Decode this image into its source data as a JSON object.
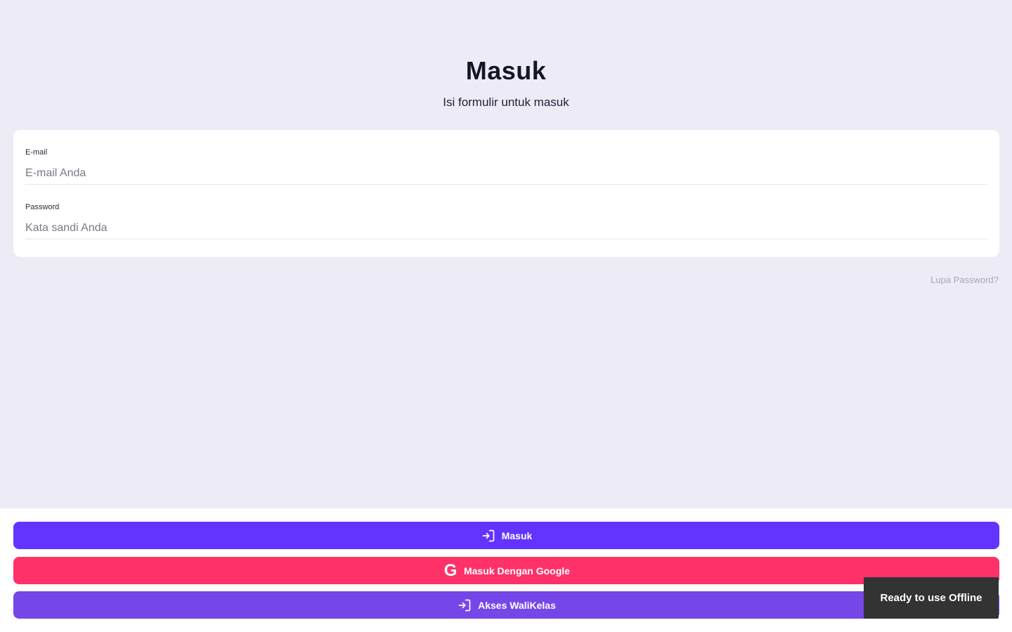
{
  "header": {
    "title": "Masuk",
    "subtitle": "Isi formulir untuk masuk"
  },
  "form": {
    "email": {
      "label": "E-mail",
      "placeholder": "E-mail Anda",
      "value": ""
    },
    "password": {
      "label": "Password",
      "placeholder": "Kata sandi Anda",
      "value": ""
    },
    "forgot_label": "Lupa Password?"
  },
  "actions": {
    "login": {
      "label": "Masuk",
      "icon": "login-icon",
      "color": "#6333ff"
    },
    "google": {
      "label": "Masuk Dengan Google",
      "icon": "google-icon",
      "color": "#fe3169"
    },
    "wali": {
      "label": "Akses WaliKelas",
      "icon": "login-icon",
      "color": "#7547e8"
    }
  },
  "toast": {
    "text": "Ready to use Offline"
  },
  "colors": {
    "background": "#ecebf6",
    "card": "#ffffff",
    "toast": "#333333"
  }
}
